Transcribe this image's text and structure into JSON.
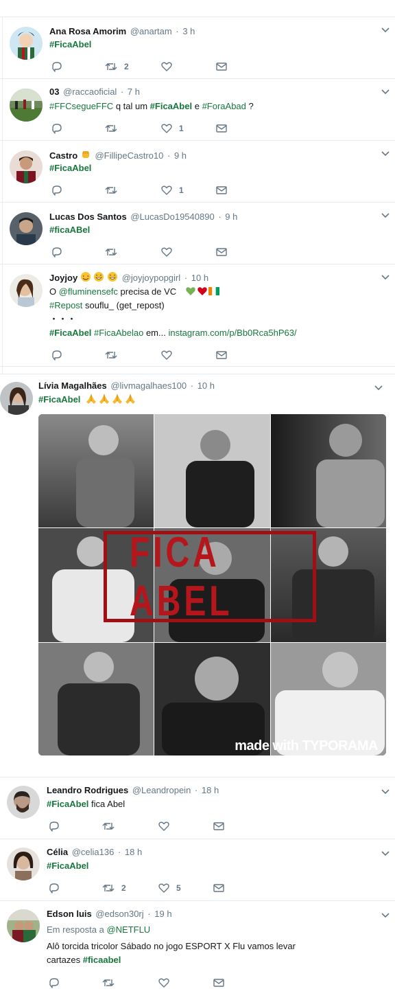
{
  "colors": {
    "hashtag": "#17773d",
    "name": "#14171a",
    "meta": "#657786",
    "border": "#e6ecf0",
    "heart_red": "#d0021b",
    "heart_green": "#77b255"
  },
  "tweets": [
    {
      "name": "Ana Rosa Amorim",
      "handle": "@anartam",
      "time": "3 h",
      "lines": [
        [
          {
            "t": "#FicaAbel",
            "k": "hb"
          }
        ]
      ],
      "counts": {
        "reply": "",
        "retweet": "2",
        "like": "",
        "dm": ""
      }
    },
    {
      "name": "03",
      "handle": "@raccaoficial",
      "time": "7 h",
      "lines": [
        [
          {
            "t": "#FFCsegueFFC",
            "k": "h"
          },
          {
            "t": " q tal um ",
            "k": "p"
          },
          {
            "t": "#FicaAbel",
            "k": "hb"
          },
          {
            "t": " e ",
            "k": "p"
          },
          {
            "t": "#ForaAbad",
            "k": "h"
          },
          {
            "t": " ?",
            "k": "p"
          }
        ]
      ],
      "counts": {
        "reply": "",
        "retweet": "",
        "like": "1",
        "dm": ""
      }
    },
    {
      "name": "Castro",
      "handle": "@FillipeCastro10",
      "time": "9 h",
      "lines": [
        [
          {
            "t": "#FicaAbel",
            "k": "hb"
          }
        ]
      ],
      "counts": {
        "reply": "",
        "retweet": "",
        "like": "1",
        "dm": ""
      }
    },
    {
      "name": "Lucas Dos Santos",
      "handle": "@LucasDo19540890",
      "time": "9 h",
      "lines": [
        [
          {
            "t": "#ficaABel",
            "k": "hb"
          }
        ]
      ],
      "counts": {
        "reply": "",
        "retweet": "",
        "like": "",
        "dm": ""
      }
    },
    {
      "name": "Joyjoy",
      "handle": "@joyjoypopgirl",
      "time": "10 h",
      "lines": [
        [
          {
            "t": "O ",
            "k": "p"
          },
          {
            "t": "@fluminensefc",
            "k": "h"
          },
          {
            "t": " precisa de VC ",
            "k": "p"
          }
        ],
        [
          {
            "t": " #Repost",
            "k": "h"
          },
          {
            "t": " souflu_ (get_repost)",
            "k": "p"
          }
        ],
        [
          {
            "t": "・・・",
            "k": "p"
          }
        ],
        [
          {
            "t": "#FicaAbel",
            "k": "hb"
          },
          {
            "t": " ",
            "k": "p"
          },
          {
            "t": "#FicaAbelao",
            "k": "h"
          },
          {
            "t": " em... ",
            "k": "p"
          },
          {
            "t": "instagram.com/p/Bb0Rca5hP63/",
            "k": "h"
          }
        ]
      ],
      "counts": {
        "reply": "",
        "retweet": "",
        "like": "",
        "dm": ""
      }
    },
    {
      "name": "Lívia Magalhães",
      "handle": "@livmagalhaes100",
      "time": "10 h",
      "lines": [
        [
          {
            "t": "#FicaAbel",
            "k": "hb"
          },
          {
            "t": " ",
            "k": "p"
          }
        ]
      ],
      "image": {
        "overlay_text": "FICA ABEL",
        "watermark": "made with TYPORAMA"
      },
      "counts": {}
    },
    {
      "name": "Leandro Rodrigues",
      "handle": "@Leandropein",
      "time": "18 h",
      "lines": [
        [
          {
            "t": "#FicaAbel",
            "k": "hb"
          },
          {
            "t": " fica Abel",
            "k": "p"
          }
        ]
      ],
      "counts": {
        "reply": "",
        "retweet": "",
        "like": "",
        "dm": ""
      }
    },
    {
      "name": "Célia",
      "handle": "@celia136",
      "time": "18 h",
      "lines": [
        [
          {
            "t": "#FicaAbel",
            "k": "hb"
          }
        ]
      ],
      "counts": {
        "reply": "",
        "retweet": "2",
        "like": "5",
        "dm": ""
      }
    },
    {
      "name": "Edson luis",
      "handle": "@edson30rj",
      "time": "19 h",
      "lines": [
        [
          {
            "t": "Em resposta a ",
            "k": "m"
          },
          {
            "t": "@NETFLU",
            "k": "h"
          }
        ],
        [
          {
            "t": "Alô torcida tricolor  Sábado no jogo                    ESPORT  X Flu  vamos levar",
            "k": "p"
          }
        ],
        [
          {
            "t": "cartazes                    ",
            "k": "p"
          },
          {
            "t": "#ficaabel",
            "k": "hb"
          }
        ]
      ],
      "counts": {
        "reply": "",
        "retweet": "",
        "like": "",
        "dm": ""
      }
    }
  ]
}
